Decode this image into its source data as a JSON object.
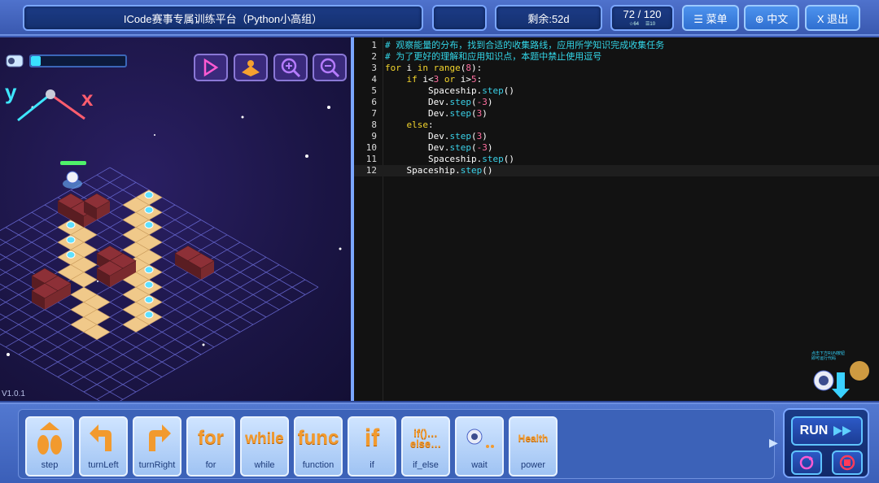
{
  "header": {
    "title": "ICode赛事专属训练平台（Python小高组）",
    "days_left": "剩余:52d",
    "score": "72 / 120",
    "stat_a": "☆64",
    "stat_b": "☰10",
    "menu_label": "☰ 菜单",
    "lang_label": "⊕ 中文",
    "exit_label": "X 退出"
  },
  "game": {
    "version": "V1.0.1",
    "energy_level": 0.1,
    "axis_y": "y",
    "axis_x": "x",
    "icons": [
      "play-speed-icon",
      "map-icon",
      "zoom-in-icon",
      "zoom-out-icon"
    ]
  },
  "editor": {
    "lines": [
      {
        "n": "1",
        "tokens": [
          [
            "com",
            "# 观察能量的分布，找到合适的收集路线，应用所学知识完成收集任务"
          ]
        ]
      },
      {
        "n": "2",
        "tokens": [
          [
            "com",
            "# 为了更好的理解和应用知识点，本题中禁止使用逗号"
          ]
        ]
      },
      {
        "n": "3",
        "tokens": [
          [
            "kw",
            "for"
          ],
          [
            "plain",
            " i "
          ],
          [
            "kw",
            "in"
          ],
          [
            "plain",
            " "
          ],
          [
            "kw",
            "range"
          ],
          [
            "plain",
            "("
          ],
          [
            "num",
            "8"
          ],
          [
            "plain",
            "):"
          ]
        ]
      },
      {
        "n": "4",
        "tokens": [
          [
            "plain",
            "    "
          ],
          [
            "kw",
            "if"
          ],
          [
            "plain",
            " i<"
          ],
          [
            "num",
            "3"
          ],
          [
            "plain",
            " "
          ],
          [
            "kw",
            "or"
          ],
          [
            "plain",
            " i>"
          ],
          [
            "num",
            "5"
          ],
          [
            "plain",
            ":"
          ]
        ]
      },
      {
        "n": "5",
        "tokens": [
          [
            "plain",
            "        Spaceship."
          ],
          [
            "fn",
            "step"
          ],
          [
            "plain",
            "()"
          ]
        ]
      },
      {
        "n": "6",
        "tokens": [
          [
            "plain",
            "        Dev."
          ],
          [
            "fn",
            "step"
          ],
          [
            "plain",
            "("
          ],
          [
            "num",
            "-3"
          ],
          [
            "plain",
            ")"
          ]
        ]
      },
      {
        "n": "7",
        "tokens": [
          [
            "plain",
            "        Dev."
          ],
          [
            "fn",
            "step"
          ],
          [
            "plain",
            "("
          ],
          [
            "num",
            "3"
          ],
          [
            "plain",
            ")"
          ]
        ]
      },
      {
        "n": "8",
        "tokens": [
          [
            "plain",
            "    "
          ],
          [
            "kw",
            "else"
          ],
          [
            "plain",
            ":"
          ]
        ]
      },
      {
        "n": "9",
        "tokens": [
          [
            "plain",
            "        Dev."
          ],
          [
            "fn",
            "step"
          ],
          [
            "plain",
            "("
          ],
          [
            "num",
            "3"
          ],
          [
            "plain",
            ")"
          ]
        ]
      },
      {
        "n": "10",
        "tokens": [
          [
            "plain",
            "        Dev."
          ],
          [
            "fn",
            "step"
          ],
          [
            "plain",
            "("
          ],
          [
            "num",
            "-3"
          ],
          [
            "plain",
            ")"
          ]
        ]
      },
      {
        "n": "11",
        "tokens": [
          [
            "plain",
            "        Spaceship."
          ],
          [
            "fn",
            "step"
          ],
          [
            "plain",
            "()"
          ]
        ]
      },
      {
        "n": "12",
        "tokens": [
          [
            "plain",
            "    Spaceship."
          ],
          [
            "fn",
            "step"
          ],
          [
            "plain",
            "()"
          ]
        ]
      }
    ],
    "active_line": 12
  },
  "blocks": [
    {
      "label": "step",
      "icon": "step-icon"
    },
    {
      "label": "turnLeft",
      "icon": "turn-left-icon"
    },
    {
      "label": "turnRight",
      "icon": "turn-right-icon"
    },
    {
      "label": "for",
      "icon_text": "for"
    },
    {
      "label": "while",
      "icon_text": "while"
    },
    {
      "label": "function",
      "icon_text": "func"
    },
    {
      "label": "if",
      "icon_text": "if"
    },
    {
      "label": "if_else",
      "icon_text": "if()…\nelse…"
    },
    {
      "label": "wait",
      "icon": "wait-icon"
    },
    {
      "label": "power",
      "icon_text": "Health"
    }
  ],
  "run": {
    "label": "RUN",
    "hint": "点击下方RUN按钮\n即可运行代码"
  },
  "colors": {
    "comment": "#33d6e8",
    "keyword": "#f3d52d",
    "number": "#ff6fa0",
    "function": "#3ad1e8",
    "accent": "#7aa6ff"
  }
}
